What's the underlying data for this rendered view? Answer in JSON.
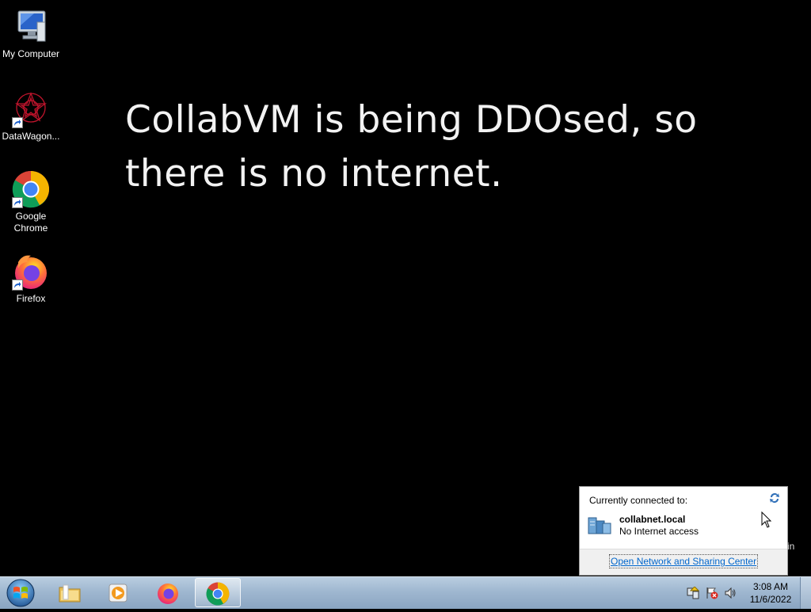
{
  "desktop": {
    "icons": [
      {
        "label": "My Computer",
        "icon": "computer-icon"
      },
      {
        "label": "DataWagon...",
        "icon": "datawagon-icon"
      },
      {
        "label": "Google Chrome",
        "icon": "chrome-icon"
      },
      {
        "label": "Firefox",
        "icon": "firefox-icon"
      }
    ],
    "wallpaper_text": {
      "line1": "CollabVM is being DDOsed, so",
      "line2": "there is no internet."
    }
  },
  "network_popup": {
    "header": "Currently connected to:",
    "network_name": "collabnet.local",
    "network_status": "No Internet access",
    "link": "Open Network and Sharing Center"
  },
  "stray_text": "in",
  "taskbar": {
    "pinned": [
      {
        "name": "windows-explorer",
        "icon": "folder-icon",
        "active": false
      },
      {
        "name": "media-player",
        "icon": "media-player-icon",
        "active": false
      },
      {
        "name": "firefox",
        "icon": "firefox-icon",
        "active": false
      },
      {
        "name": "chrome",
        "icon": "chrome-icon",
        "active": true
      }
    ],
    "clock": {
      "time": "3:08 AM",
      "date": "11/6/2022"
    }
  },
  "colors": {
    "desktop_bg": "#000000",
    "taskbar": "#9fb7d0",
    "link": "#0066cc"
  }
}
